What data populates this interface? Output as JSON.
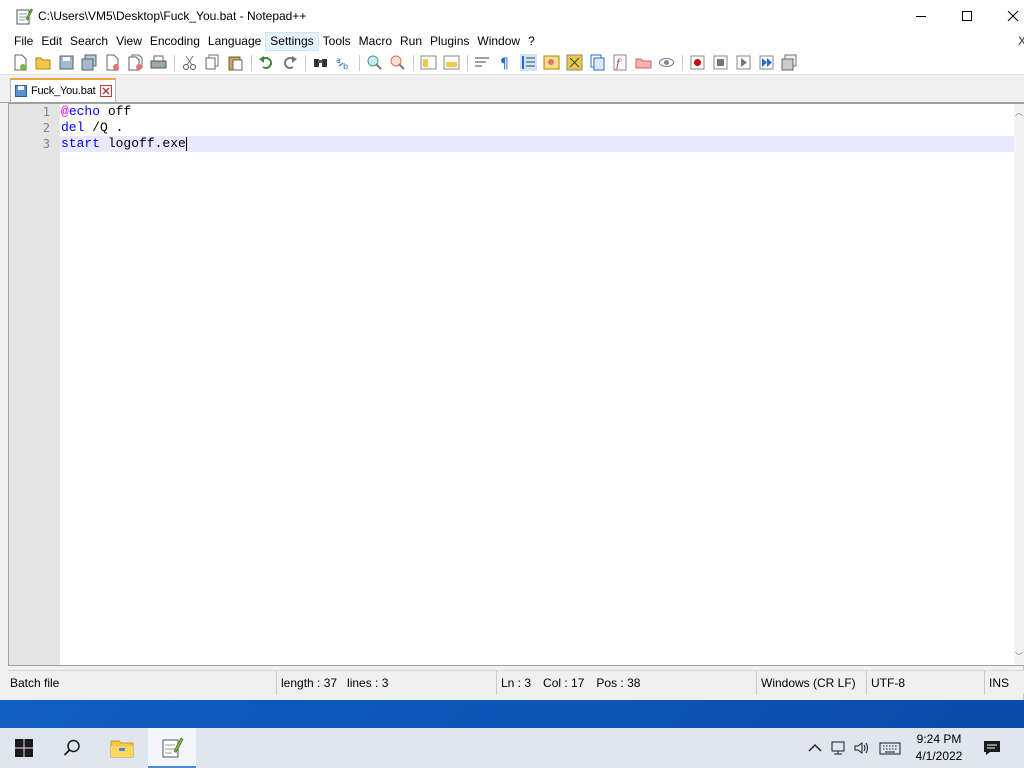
{
  "window": {
    "title": "C:\\Users\\VM5\\Desktop\\Fuck_You.bat - Notepad++"
  },
  "menu": {
    "items": [
      "File",
      "Edit",
      "Search",
      "View",
      "Encoding",
      "Language",
      "Settings",
      "Tools",
      "Macro",
      "Run",
      "Plugins",
      "Window",
      "?"
    ],
    "active": "Settings",
    "close_glyph": "X"
  },
  "tabs": [
    {
      "label": "Fuck_You.bat",
      "active": true
    }
  ],
  "editor": {
    "line_numbers": [
      "1",
      "2",
      "3"
    ],
    "lines": [
      {
        "segments": [
          {
            "text": "@",
            "style": "at"
          },
          {
            "text": "echo",
            "style": "kw"
          },
          {
            "text": " off",
            "style": "tx"
          }
        ]
      },
      {
        "segments": [
          {
            "text": "del",
            "style": "kw"
          },
          {
            "text": " /Q .",
            "style": "tx"
          }
        ]
      },
      {
        "segments": [
          {
            "text": "start",
            "style": "kw"
          },
          {
            "text": " logoff.exe",
            "style": "tx"
          }
        ],
        "current": true
      }
    ],
    "colors": {
      "keyword": "#0000ff",
      "at_sign": "#ff00ff",
      "current_line": "#e8e8ff"
    }
  },
  "status": {
    "file_type": "Batch file",
    "length": "length : 37",
    "lines": "lines : 3",
    "ln": "Ln : 3",
    "col": "Col : 17",
    "pos": "Pos : 38",
    "eol": "Windows (CR LF)",
    "encoding": "UTF-8",
    "mode": "INS"
  },
  "taskbar": {
    "time": "9:24 PM",
    "date": "4/1/2022"
  }
}
